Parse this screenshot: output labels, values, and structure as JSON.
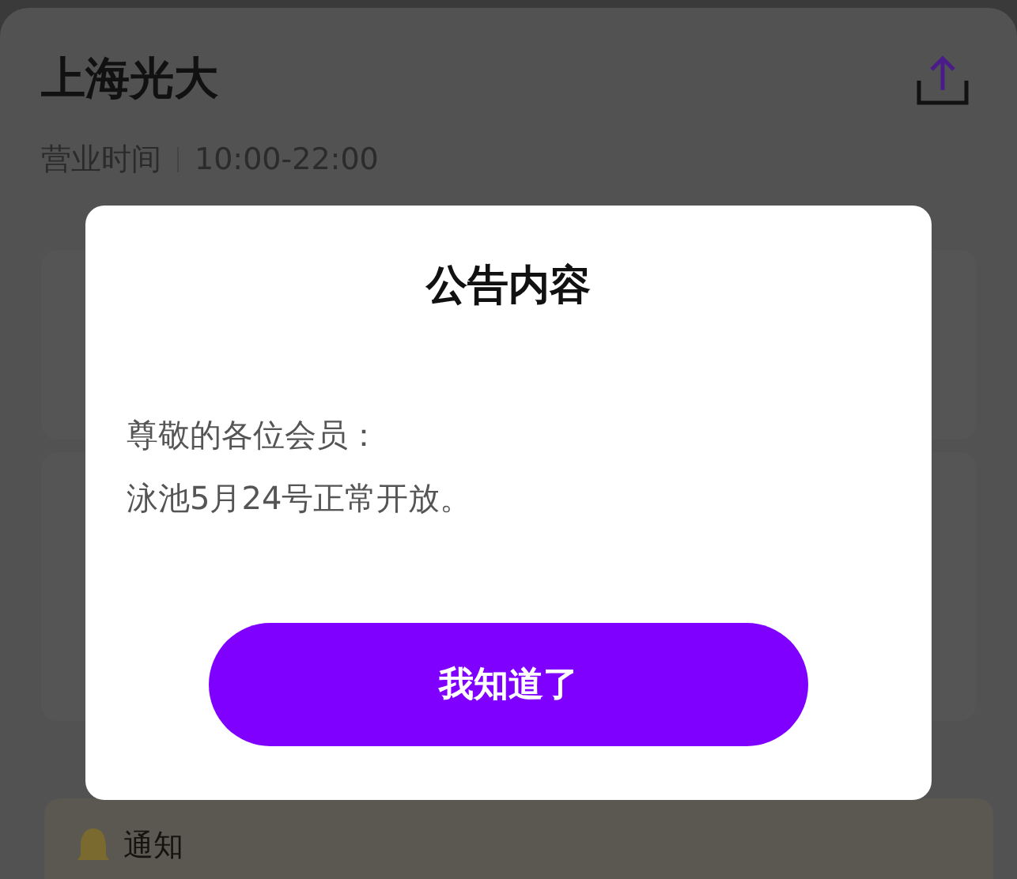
{
  "page": {
    "title": "上海光大",
    "hours_label": "营业时间",
    "hours": "10:00-22:00"
  },
  "notice_bar": {
    "label": "通知"
  },
  "dialog": {
    "title": "公告内容",
    "lines": [
      "尊敬的各位会员：",
      "泳池5月24号正常开放。"
    ],
    "button": "我知道了"
  }
}
